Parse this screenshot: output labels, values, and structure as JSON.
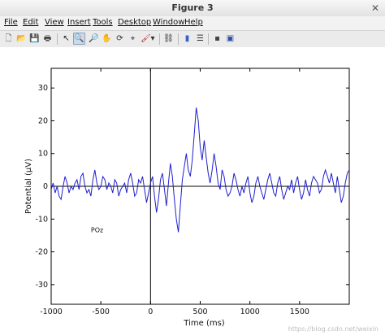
{
  "window": {
    "title": "Figure 3",
    "close_glyph": "✕"
  },
  "menu": [
    "File",
    "Edit",
    "View",
    "Insert",
    "Tools",
    "Desktop",
    "Window",
    "Help"
  ],
  "toolbar": [
    {
      "name": "new-figure-icon",
      "glyph": "🗋"
    },
    {
      "name": "open-file-icon",
      "glyph": "📂"
    },
    {
      "name": "save-figure-icon",
      "glyph": "💾"
    },
    {
      "name": "print-figure-icon",
      "glyph": "🖶"
    },
    {
      "name": "edit-plot-icon",
      "glyph": "↖"
    },
    {
      "name": "zoom-in-icon",
      "glyph": "🔍"
    },
    {
      "name": "zoom-out-icon",
      "glyph": "🔎"
    },
    {
      "name": "pan-icon",
      "glyph": "✋"
    },
    {
      "name": "rotate-3d-icon",
      "glyph": "⟳"
    },
    {
      "name": "data-cursor-icon",
      "glyph": "⌖"
    },
    {
      "name": "brush-icon",
      "glyph": "🖌"
    },
    {
      "name": "brush-dropdown-icon",
      "glyph": "▾"
    },
    {
      "name": "link-plot-icon",
      "glyph": "⛓"
    },
    {
      "name": "insert-colorbar-icon",
      "glyph": "▮"
    },
    {
      "name": "insert-legend-icon",
      "glyph": "☰"
    },
    {
      "name": "hide-plot-tools-icon",
      "glyph": "▪"
    },
    {
      "name": "show-plot-tools-icon",
      "glyph": "▣"
    }
  ],
  "colors": {
    "line": "#1f1fd0",
    "axes": "#000000",
    "background": "#ffffff"
  },
  "watermark": "https://blog.csdn.net/weixin",
  "chart_data": {
    "type": "line",
    "title": "",
    "xlabel": "Time (ms)",
    "ylabel": "Potential (μV)",
    "xlim": [
      -1000,
      2000
    ],
    "ylim": [
      -36,
      36
    ],
    "xticks": [
      -1000,
      -500,
      0,
      500,
      1000,
      1500
    ],
    "xtick_labels": [
      "-1000",
      "-500",
      "0",
      "500",
      "1000",
      "1500"
    ],
    "yticks": [
      -30,
      -20,
      -10,
      0,
      10,
      20,
      30
    ],
    "ytick_labels": [
      "-30",
      "-20",
      "-10",
      "0",
      "10",
      "20",
      "30"
    ],
    "annotation": "POz",
    "series": [
      {
        "x": [
          -1000,
          -980,
          -960,
          -940,
          -920,
          -900,
          -880,
          -860,
          -840,
          -820,
          -800,
          -780,
          -760,
          -740,
          -720,
          -700,
          -680,
          -660,
          -640,
          -620,
          -600,
          -580,
          -560,
          -540,
          -520,
          -500,
          -480,
          -460,
          -440,
          -420,
          -400,
          -380,
          -360,
          -340,
          -320,
          -300,
          -280,
          -260,
          -240,
          -220,
          -200,
          -180,
          -160,
          -140,
          -120,
          -100,
          -80,
          -60,
          -40,
          -20,
          0,
          20,
          40,
          60,
          80,
          100,
          120,
          140,
          160,
          180,
          200,
          220,
          240,
          260,
          280,
          300,
          320,
          340,
          360,
          380,
          400,
          420,
          440,
          460,
          480,
          500,
          520,
          540,
          560,
          580,
          600,
          620,
          640,
          660,
          680,
          700,
          720,
          740,
          760,
          780,
          800,
          820,
          840,
          860,
          880,
          900,
          920,
          940,
          960,
          980,
          1000,
          1020,
          1040,
          1060,
          1080,
          1100,
          1120,
          1140,
          1160,
          1180,
          1200,
          1220,
          1240,
          1260,
          1280,
          1300,
          1320,
          1340,
          1360,
          1380,
          1400,
          1420,
          1440,
          1460,
          1480,
          1500,
          1520,
          1540,
          1560,
          1580,
          1600,
          1620,
          1640,
          1660,
          1680,
          1700,
          1720,
          1740,
          1760,
          1780,
          1800,
          1820,
          1840,
          1860,
          1880,
          1900,
          1920,
          1940,
          1960,
          1980,
          2000
        ],
        "y": [
          -1,
          1,
          -2,
          0,
          -3,
          -4,
          0,
          3,
          1,
          -2,
          0,
          -1,
          1,
          2,
          -1,
          3,
          4,
          0,
          -2,
          -1,
          -3,
          2,
          5,
          1,
          -1,
          0,
          3,
          2,
          -1,
          1,
          0,
          -2,
          2,
          1,
          -3,
          -1,
          0,
          1,
          -2,
          2,
          4,
          1,
          -3,
          -2,
          2,
          1,
          3,
          -1,
          -5,
          -2,
          1,
          3,
          -3,
          -8,
          -4,
          2,
          4,
          -1,
          -6,
          1,
          7,
          3,
          -4,
          -10,
          -14,
          -6,
          2,
          6,
          10,
          5,
          3,
          8,
          16,
          24,
          20,
          12,
          8,
          14,
          9,
          4,
          1,
          5,
          10,
          6,
          1,
          -1,
          5,
          3,
          -1,
          -3,
          -2,
          0,
          4,
          2,
          -1,
          -3,
          0,
          -2,
          1,
          3,
          -2,
          -5,
          -3,
          1,
          3,
          0,
          -2,
          -4,
          -1,
          2,
          4,
          1,
          -2,
          -3,
          1,
          3,
          -1,
          -4,
          -2,
          0,
          -1,
          2,
          -2,
          1,
          3,
          -1,
          -4,
          -2,
          2,
          -1,
          -3,
          1,
          3,
          2,
          1,
          -2,
          -1,
          3,
          5,
          3,
          1,
          4,
          1,
          -2,
          3,
          -1,
          -5,
          -3,
          1,
          4,
          5
        ]
      }
    ]
  }
}
